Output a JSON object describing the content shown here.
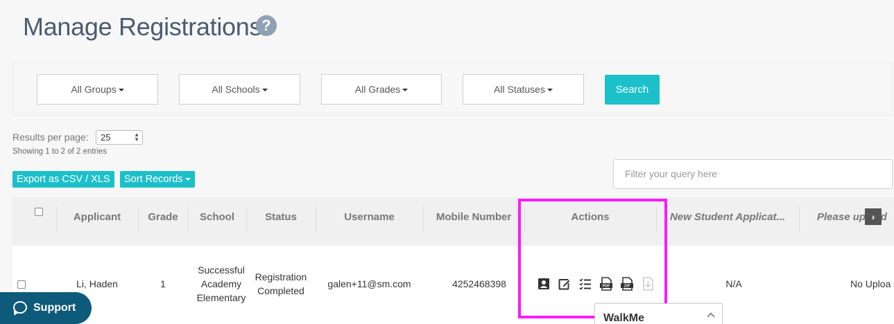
{
  "page": {
    "title": "Manage Registrations",
    "help_icon": "question-circle-icon"
  },
  "filters": {
    "groups": "All Groups",
    "schools": "All Schools",
    "grades": "All Grades",
    "statuses": "All Statuses",
    "search_label": "Search"
  },
  "results": {
    "per_page_label": "Results per page:",
    "per_page_value": "25",
    "showing": "Showing 1 to 2 of 2 entries"
  },
  "toolbar": {
    "export_label": "Export as CSV / XLS",
    "sort_label": "Sort Records",
    "filter_placeholder": "Filter your query here"
  },
  "table": {
    "headers": {
      "applicant": "Applicant",
      "grade": "Grade",
      "school": "School",
      "status": "Status",
      "username": "Username",
      "mobile": "Mobile Number",
      "actions": "Actions",
      "new_student_app": "New Student Applicat...",
      "please_upload": "Please upload"
    },
    "rows": [
      {
        "applicant": "Li, Haden",
        "grade": "1",
        "school_line1": "Successful",
        "school_line2": "Academy",
        "school_line3": "Elementary",
        "status_line1": "Registration",
        "status_line2": "Completed",
        "username": "galen+11@sm.com",
        "mobile": "4252468398",
        "new_student_app": "N/A",
        "please_upload": "No Uploa"
      }
    ],
    "action_icons": [
      "profile-icon",
      "edit-icon",
      "checklist-icon",
      "pdf-icon",
      "zip-icon",
      "download-disabled-icon"
    ]
  },
  "support": {
    "label": "Support"
  },
  "walkme": {
    "label": "WalkMe"
  },
  "colors": {
    "accent": "#1cc0c9",
    "highlight": "#ff19ff",
    "support_bg": "#0e5a7a"
  }
}
